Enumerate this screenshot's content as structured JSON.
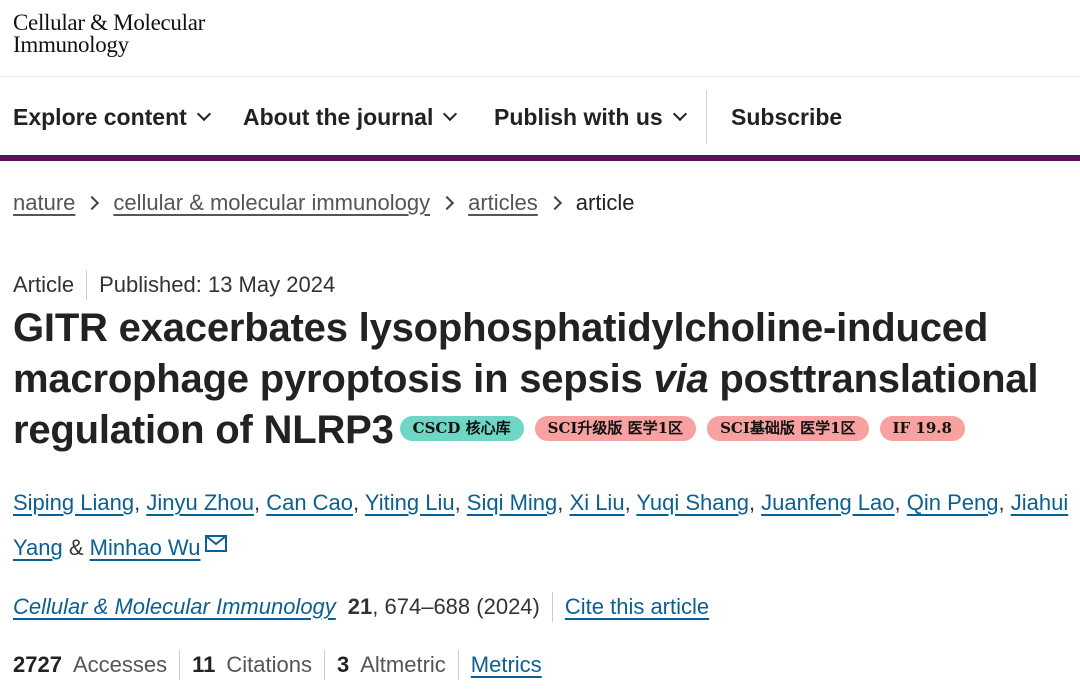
{
  "logo": {
    "line1": "Cellular & Molecular",
    "line2": "Immunology"
  },
  "nav": {
    "explore": "Explore content",
    "about": "About the journal",
    "publish": "Publish with us",
    "subscribe": "Subscribe"
  },
  "breadcrumb": [
    "nature",
    "cellular & molecular immunology",
    "articles",
    "article"
  ],
  "article": {
    "type": "Article",
    "published": "Published: 13 May 2024",
    "title_part1": "GITR exacerbates lysophosphatidylcholine-induced macrophage pyroptosis in sepsis ",
    "title_italic": "via",
    "title_part2": " posttranslational regulation of NLRP3"
  },
  "badges": [
    "CSCD 核心库",
    "SCI升级版 医学1区",
    "SCI基础版 医学1区",
    "IF 19.8"
  ],
  "authors": [
    "Siping Liang",
    "Jinyu Zhou",
    "Can Cao",
    "Yiting Liu",
    "Siqi Ming",
    "Xi Liu",
    "Yuqi Shang",
    "Juanfeng Lao",
    "Qin Peng",
    "Jiahui Yang",
    "Minhao Wu"
  ],
  "author_separator": ", ",
  "author_conjunction": " & ",
  "citation": {
    "journal": "Cellular & Molecular Immunology",
    "volume": "21",
    "pages": ", 674–688 (2024)",
    "cite_link": "Cite this article"
  },
  "metrics": {
    "accesses_value": "2727",
    "accesses_label": "Accesses",
    "citations_value": "11",
    "citations_label": "Citations",
    "altmetric_value": "3",
    "altmetric_label": "Altmetric",
    "metrics_link": "Metrics"
  },
  "icons": {
    "chevron": "chevron-down-icon",
    "breadcrumb_sep": "chevron-right-icon",
    "email": "envelope-icon"
  },
  "colors": {
    "brand_bar": "#5b1160",
    "link": "#0c6091",
    "badge_teal": "#6fd6c5",
    "badge_pink": "#f7a1a0"
  }
}
